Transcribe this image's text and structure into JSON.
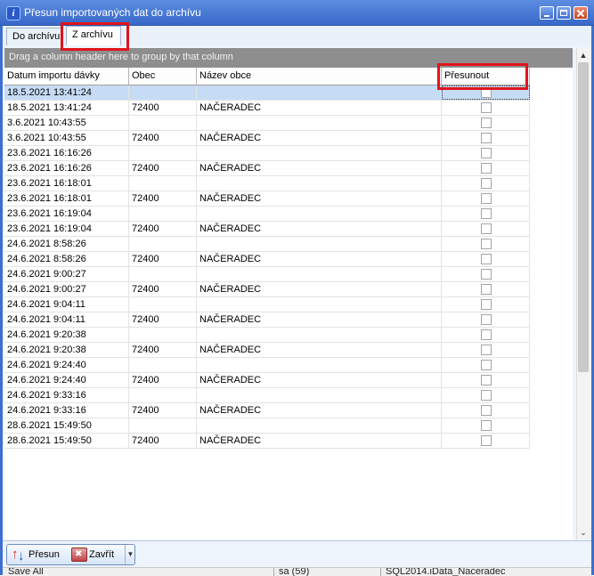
{
  "window": {
    "title": "Přesun importovaných dat do archívu",
    "icon": "info-icon"
  },
  "tabs": [
    {
      "label": "Do archívu",
      "active": false
    },
    {
      "label": "Z archívu",
      "active": true
    }
  ],
  "group_panel": {
    "text": "Drag a column header here to group by that column"
  },
  "grid": {
    "columns": [
      "Datum importu dávky",
      "Obec",
      "Název obce",
      "Přesunout"
    ],
    "rows": [
      {
        "date": "18.5.2021 13:41:24",
        "obec": "",
        "nazev": "",
        "presunout": false,
        "selected": true
      },
      {
        "date": "18.5.2021 13:41:24",
        "obec": "72400",
        "nazev": "NAČERADEC",
        "presunout": false
      },
      {
        "date": "3.6.2021 10:43:55",
        "obec": "",
        "nazev": "",
        "presunout": false
      },
      {
        "date": "3.6.2021 10:43:55",
        "obec": "72400",
        "nazev": "NAČERADEC",
        "presunout": false
      },
      {
        "date": "23.6.2021 16:16:26",
        "obec": "",
        "nazev": "",
        "presunout": false
      },
      {
        "date": "23.6.2021 16:16:26",
        "obec": "72400",
        "nazev": "NAČERADEC",
        "presunout": false
      },
      {
        "date": "23.6.2021 16:18:01",
        "obec": "",
        "nazev": "",
        "presunout": false
      },
      {
        "date": "23.6.2021 16:18:01",
        "obec": "72400",
        "nazev": "NAČERADEC",
        "presunout": false
      },
      {
        "date": "23.6.2021 16:19:04",
        "obec": "",
        "nazev": "",
        "presunout": false
      },
      {
        "date": "23.6.2021 16:19:04",
        "obec": "72400",
        "nazev": "NAČERADEC",
        "presunout": false
      },
      {
        "date": "24.6.2021 8:58:26",
        "obec": "",
        "nazev": "",
        "presunout": false
      },
      {
        "date": "24.6.2021 8:58:26",
        "obec": "72400",
        "nazev": "NAČERADEC",
        "presunout": false
      },
      {
        "date": "24.6.2021 9:00:27",
        "obec": "",
        "nazev": "",
        "presunout": false
      },
      {
        "date": "24.6.2021 9:00:27",
        "obec": "72400",
        "nazev": "NAČERADEC",
        "presunout": false
      },
      {
        "date": "24.6.2021 9:04:11",
        "obec": "",
        "nazev": "",
        "presunout": false
      },
      {
        "date": "24.6.2021 9:04:11",
        "obec": "72400",
        "nazev": "NAČERADEC",
        "presunout": false
      },
      {
        "date": "24.6.2021 9:20:38",
        "obec": "",
        "nazev": "",
        "presunout": false
      },
      {
        "date": "24.6.2021 9:20:38",
        "obec": "72400",
        "nazev": "NAČERADEC",
        "presunout": false
      },
      {
        "date": "24.6.2021 9:24:40",
        "obec": "",
        "nazev": "",
        "presunout": false
      },
      {
        "date": "24.6.2021 9:24:40",
        "obec": "72400",
        "nazev": "NAČERADEC",
        "presunout": false
      },
      {
        "date": "24.6.2021 9:33:16",
        "obec": "",
        "nazev": "",
        "presunout": false
      },
      {
        "date": "24.6.2021 9:33:16",
        "obec": "72400",
        "nazev": "NAČERADEC",
        "presunout": false
      },
      {
        "date": "28.6.2021 15:49:50",
        "obec": "",
        "nazev": "",
        "presunout": false
      },
      {
        "date": "28.6.2021 15:49:50",
        "obec": "72400",
        "nazev": "NAČERADEC",
        "presunout": false
      }
    ]
  },
  "toolbar": {
    "move_label": "Přesun",
    "close_label": "Zavřít"
  },
  "statusbar": {
    "left": "Save All",
    "middle": "sa (59)",
    "right": "SQL2014.iData_Naceradec"
  },
  "colors": {
    "title_bar": "#3768c9",
    "highlight_box": "#e0141c",
    "group_panel": "#8e8e8e",
    "selected_row": "#c6dcf5"
  }
}
